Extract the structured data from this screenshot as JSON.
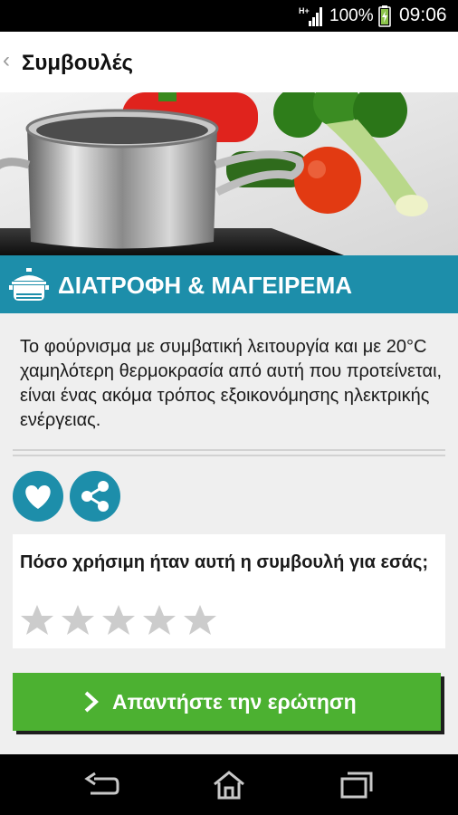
{
  "status_bar": {
    "network": "H+",
    "battery_percent": "100%",
    "time": "09:06"
  },
  "action_bar": {
    "title": "Συμβουλές"
  },
  "category": {
    "title": "ΔΙΑΤΡΟΦΗ & ΜΑΓΕΙΡΕΜΑ",
    "icon": "cooking-pot-icon"
  },
  "tip": {
    "text": "Το φούρνισμα με συμβατική λειτουργία και με 20°C χαμηλότερη θερμοκρασία από αυτή που προτείνεται, είναι ένας ακόμα τρόπος εξοικονόμησης ηλεκτρικής ενέργειας."
  },
  "actions": {
    "like_icon": "heart-icon",
    "share_icon": "share-icon"
  },
  "rating": {
    "question": "Πόσο χρήσιμη ήταν αυτή η συμβουλή για εσάς;",
    "max_stars": 5,
    "selected_stars": 0
  },
  "answer_button": {
    "label": "Απαντήστε την ερώτηση"
  },
  "colors": {
    "accent": "#1d8eaa",
    "button_green": "#4cb131",
    "star_empty": "#cccccc"
  }
}
